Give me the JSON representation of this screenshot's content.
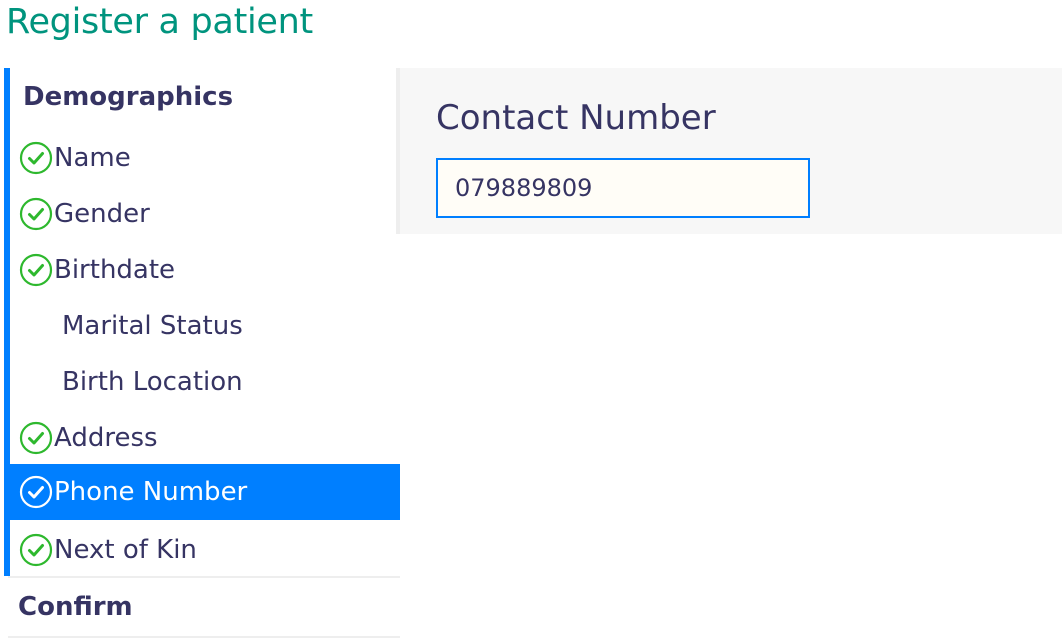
{
  "page": {
    "title": "Register a patient"
  },
  "sidebar": {
    "sections": [
      {
        "heading": "Demographics",
        "items": [
          {
            "label": "Name",
            "completed": true,
            "active": false
          },
          {
            "label": "Gender",
            "completed": true,
            "active": false
          },
          {
            "label": "Birthdate",
            "completed": true,
            "active": false
          },
          {
            "label": "Marital Status",
            "completed": false,
            "active": false
          },
          {
            "label": "Birth Location",
            "completed": false,
            "active": false
          },
          {
            "label": "Address",
            "completed": true,
            "active": false
          },
          {
            "label": "Phone Number",
            "completed": true,
            "active": true
          },
          {
            "label": "Next of Kin",
            "completed": true,
            "active": false
          }
        ]
      },
      {
        "heading": "Confirm",
        "items": []
      }
    ]
  },
  "form": {
    "field_label": "Contact Number",
    "field_value": "079889809"
  },
  "colors": {
    "title": "#00947e",
    "accent": "#007fff",
    "check": "#2eb82e",
    "text": "#363463"
  },
  "icons": {
    "completed": "check-circle-icon"
  }
}
